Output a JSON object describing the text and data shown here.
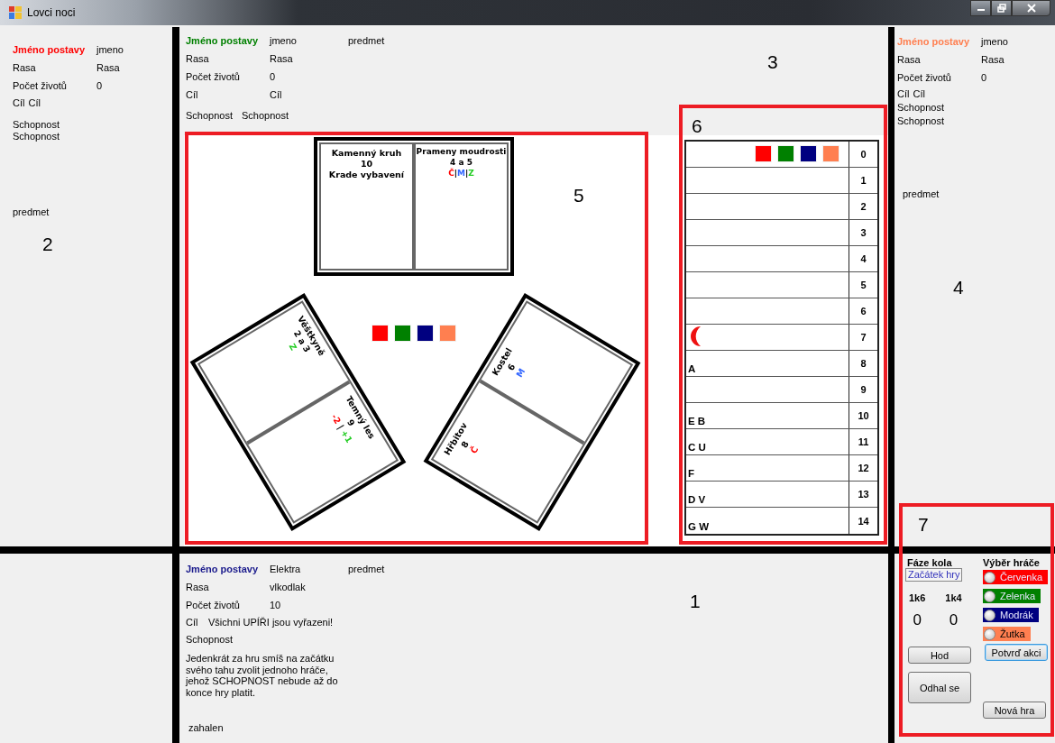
{
  "window": {
    "title": "Lovci noci"
  },
  "players": [
    {
      "kind": "side",
      "color": "#ff0000",
      "name_label": "Jméno postavy",
      "name": "jmeno",
      "race_label": "Rasa",
      "race": "Rasa",
      "lives_label": "Počet životů",
      "lives": "0",
      "goal_label": "Cíl",
      "goal": "Cíl",
      "ability_label": "Schopnost",
      "ability": "Schopnost",
      "item": "predmet"
    },
    {
      "kind": "wide",
      "color": "#008000",
      "name_label": "Jméno postavy",
      "name": "jmeno",
      "race_label": "Rasa",
      "race": "Rasa",
      "lives_label": "Počet životů",
      "lives": "0",
      "goal_label": "Cíl",
      "goal": "Cíl",
      "ability_label": "Schopnost",
      "ability": "Schopnost",
      "item": "predmet"
    },
    {
      "kind": "side",
      "color": "#ff7f50",
      "name_label": "Jméno postavy",
      "name": "jmeno",
      "race_label": "Rasa",
      "race": "Rasa",
      "lives_label": "Počet životů",
      "lives": "0",
      "goal_label": "Cíl",
      "goal": "Cíl",
      "ability_label": "Schopnost",
      "ability": "Schopnost",
      "item": "predmet"
    },
    {
      "kind": "detail",
      "color": "#1a1a8c",
      "name_label": "Jméno postavy",
      "name": "Elektra",
      "race_label": "Rasa",
      "race": "vlkodlak",
      "lives_label": "Počet životů",
      "lives": "10",
      "goal_label": "Cíl",
      "goal": "Všichni UPÍŘI jsou vyřazeni!",
      "ability_label": "Schopnost",
      "ability": "Jedenkrát za hru smíš na začátku svého tahu zvolit jednoho hráče, jehož SCHOPNOST nebude až do konce hry platit.",
      "item": "predmet",
      "status": "zahalen"
    }
  ],
  "board": {
    "cards": [
      {
        "kind": "flat",
        "halves": [
          {
            "title": "Kamenný kruh",
            "number": "10",
            "effect": "Krade vybavení"
          },
          {
            "title": "Prameny moudrosti",
            "number": "4 a 5",
            "separator": "|",
            "tags": [
              {
                "text": "Č",
                "color": "#ff0000"
              },
              {
                "text": "M",
                "color": "#3366ff"
              },
              {
                "text": "Z",
                "color": "#22cc22"
              }
            ]
          }
        ]
      },
      {
        "kind": "tilt-left",
        "halves": [
          {
            "title": "Věštkyně",
            "number": "2 a 3",
            "tags": [
              {
                "text": "Z",
                "color": "#22cc22"
              }
            ]
          },
          {
            "title": "Temný les",
            "number": "9",
            "separator": " | ",
            "tags": [
              {
                "text": "-2",
                "color": "#ff0000"
              },
              {
                "text": "+1",
                "color": "#22cc22"
              }
            ]
          }
        ]
      },
      {
        "kind": "tilt-right",
        "halves": [
          {
            "title": "Hřbitov",
            "number": "8",
            "tags": [
              {
                "text": "Č",
                "color": "#ff0000"
              }
            ]
          },
          {
            "title": "Kostel",
            "number": "6",
            "tags": [
              {
                "text": "M",
                "color": "#3366ff"
              }
            ]
          }
        ]
      }
    ],
    "tokens": [
      {
        "color": "#ff0000"
      },
      {
        "color": "#008000"
      },
      {
        "color": "#000080"
      },
      {
        "color": "#ff7f50"
      }
    ]
  },
  "track": {
    "rows": [
      {
        "number": "0",
        "kind": "tokens",
        "tokens": [
          {
            "color": "#ff0000"
          },
          {
            "color": "#008000"
          },
          {
            "color": "#000080"
          },
          {
            "color": "#ff7f50"
          }
        ]
      },
      {
        "number": "1",
        "kind": "empty"
      },
      {
        "number": "2",
        "kind": "empty"
      },
      {
        "number": "3",
        "kind": "empty"
      },
      {
        "number": "4",
        "kind": "empty"
      },
      {
        "number": "5",
        "kind": "empty"
      },
      {
        "number": "6",
        "kind": "empty"
      },
      {
        "number": "7",
        "kind": "moon"
      },
      {
        "number": "8",
        "kind": "letters",
        "letters": "A"
      },
      {
        "number": "9",
        "kind": "empty"
      },
      {
        "number": "10",
        "kind": "letters",
        "letters": "E B"
      },
      {
        "number": "11",
        "kind": "letters",
        "letters": "C U"
      },
      {
        "number": "12",
        "kind": "letters",
        "letters": "F"
      },
      {
        "number": "13",
        "kind": "letters",
        "letters": "D V"
      },
      {
        "number": "14",
        "kind": "letters",
        "letters": "G W"
      }
    ]
  },
  "controls": {
    "phase_label": "Fáze kola",
    "phase": "Začátek hry",
    "dice": [
      {
        "label": "1k6",
        "value": "0"
      },
      {
        "label": "1k4",
        "value": "0"
      }
    ],
    "roll": "Hod",
    "reveal": "Odhal se",
    "player_label": "Výběr hráče",
    "choices": [
      {
        "name": "Červenka",
        "color": "#ff0000",
        "selected": false
      },
      {
        "name": "Zelenka",
        "color": "#008000",
        "selected": false
      },
      {
        "name": "Modrák",
        "color": "#000080",
        "selected": false
      },
      {
        "name": "Žutka",
        "color": "#ff7f50",
        "selected": false
      }
    ],
    "confirm": "Potvrď akci",
    "new_game": "Nová hra"
  },
  "annotations": [
    {
      "label": "1",
      "framed": false
    },
    {
      "label": "2",
      "framed": false
    },
    {
      "label": "3",
      "framed": false
    },
    {
      "label": "4",
      "framed": false
    },
    {
      "label": "5",
      "framed": true
    },
    {
      "label": "6",
      "framed": true
    },
    {
      "label": "7",
      "framed": true
    }
  ]
}
